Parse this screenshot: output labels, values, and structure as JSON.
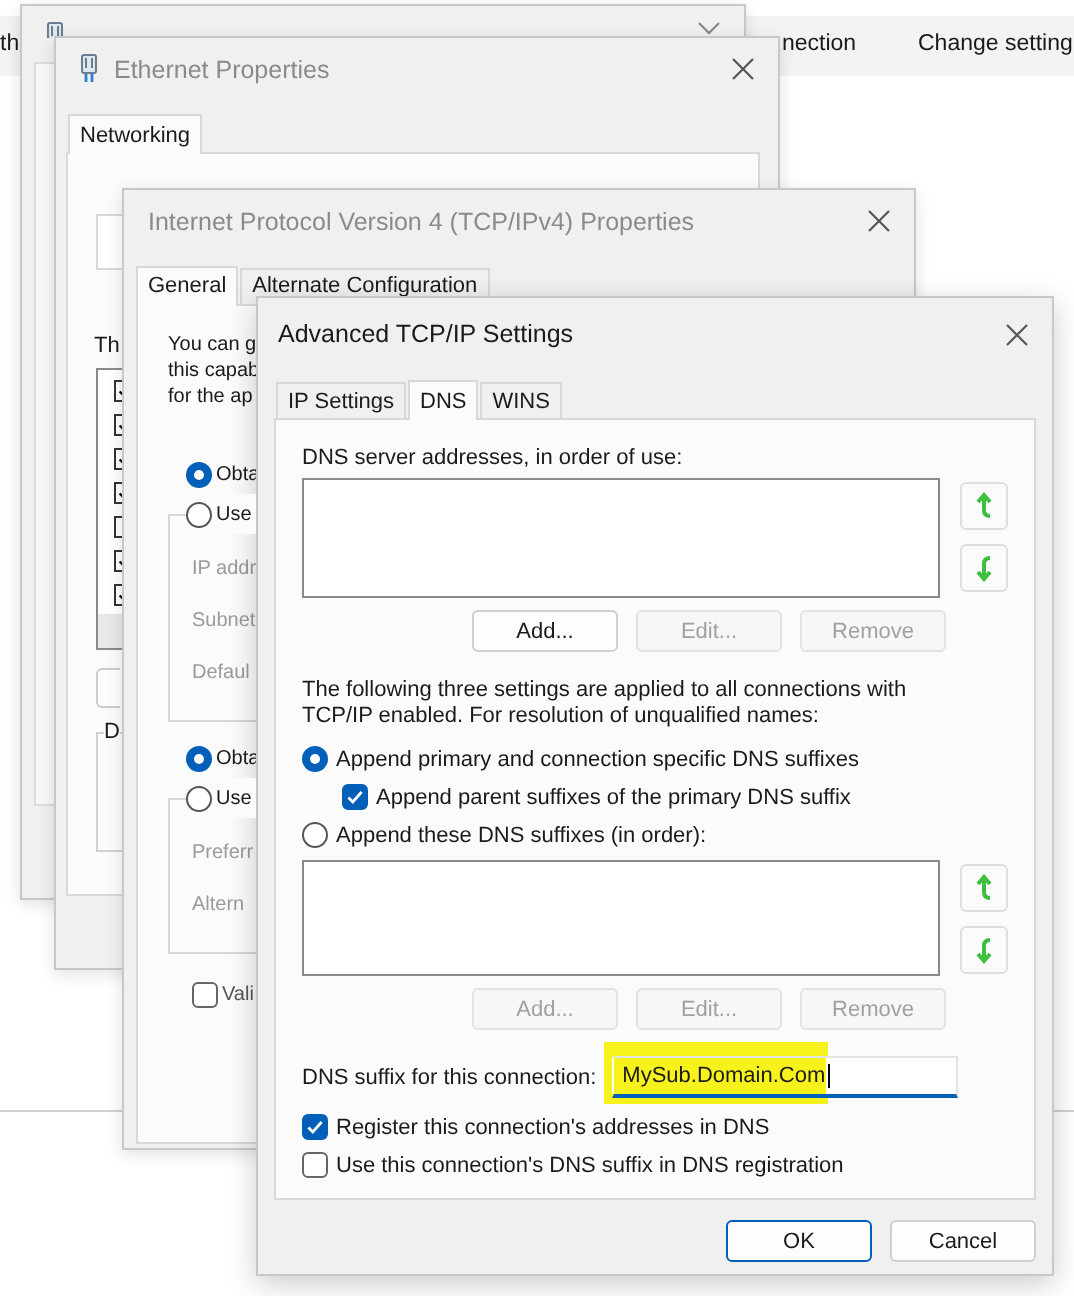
{
  "background_bar": {
    "items": [
      "th",
      "nection",
      "Change setting"
    ]
  },
  "ethernet_properties": {
    "title": "Ethernet Properties",
    "tabs": [
      {
        "label": "Networking",
        "selected": true
      }
    ],
    "items_label": "Th",
    "items": [
      {
        "checked": true
      },
      {
        "checked": true
      },
      {
        "checked": true
      },
      {
        "checked": true
      },
      {
        "checked": false
      },
      {
        "checked": true
      },
      {
        "checked": true
      }
    ],
    "group_label": "D"
  },
  "ipv4_properties": {
    "title": "Internet Protocol Version 4 (TCP/IPv4) Properties",
    "tabs": [
      {
        "label": "General",
        "selected": true
      },
      {
        "label": "Alternate Configuration",
        "selected": false
      }
    ],
    "intro_lines": [
      "You can g",
      "this capab",
      "for the ap"
    ],
    "address_options": [
      {
        "label": "Obta",
        "selected": true
      },
      {
        "label": "Use",
        "selected": false
      }
    ],
    "address_fields": [
      "IP addr",
      "Subnet",
      "Defaul"
    ],
    "dns_options": [
      {
        "label": "Obta",
        "selected": true
      },
      {
        "label": "Use",
        "selected": false
      }
    ],
    "dns_fields": [
      "Preferr",
      "Altern"
    ],
    "validate": {
      "label": "Vali",
      "checked": false
    }
  },
  "advanced_dialog": {
    "title": "Advanced TCP/IP Settings",
    "tabs": [
      {
        "label": "IP Settings",
        "selected": false
      },
      {
        "label": "DNS",
        "selected": true
      },
      {
        "label": "WINS",
        "selected": false
      }
    ],
    "server_list": {
      "label": "DNS server addresses, in order of use:",
      "buttons": [
        {
          "label": "Add...",
          "disabled": false
        },
        {
          "label": "Edit...",
          "disabled": true
        },
        {
          "label": "Remove",
          "disabled": true
        }
      ]
    },
    "note": "The following three settings are applied to all connections with TCP/IP enabled. For resolution of unqualified names:",
    "options": [
      {
        "kind": "radio",
        "label": "Append primary and connection specific DNS suffixes",
        "selected": true
      },
      {
        "kind": "checkbox",
        "label": "Append parent suffixes of the primary DNS suffix",
        "checked": true
      },
      {
        "kind": "radio",
        "label": "Append these DNS suffixes (in order):",
        "selected": false
      }
    ],
    "suffix_list": {
      "buttons": [
        {
          "label": "Add...",
          "disabled": true
        },
        {
          "label": "Edit...",
          "disabled": true
        },
        {
          "label": "Remove",
          "disabled": true
        }
      ]
    },
    "suffix_field": {
      "label": "DNS suffix for this connection:",
      "value": "MySub.Domain.Com",
      "highlighted": true
    },
    "registration": [
      {
        "label": "Register this connection's addresses in DNS",
        "checked": true
      },
      {
        "label": "Use this connection's DNS suffix in DNS registration",
        "checked": false
      }
    ],
    "buttons": [
      {
        "label": "OK",
        "default": true
      },
      {
        "label": "Cancel",
        "default": false
      }
    ]
  }
}
